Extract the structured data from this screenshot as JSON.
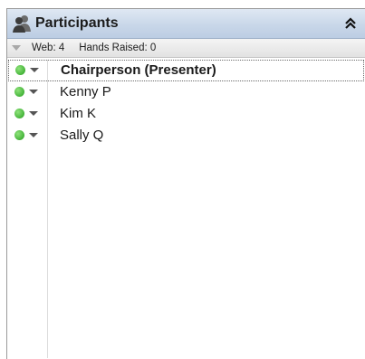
{
  "panel": {
    "title": "Participants",
    "header_icon": "participants-icon",
    "collapse_icon": "double-chevron-up-icon"
  },
  "subbar": {
    "web": "Web: 4",
    "hands_raised": "Hands Raised: 0"
  },
  "participants": [
    {
      "name": "Chairperson (Presenter)",
      "status_color": "#45b43a",
      "selected": true
    },
    {
      "name": "Kenny P",
      "status_color": "#45b43a",
      "selected": false
    },
    {
      "name": "Kim K",
      "status_color": "#45b43a",
      "selected": false
    },
    {
      "name": "Sally Q",
      "status_color": "#45b43a",
      "selected": false
    }
  ]
}
